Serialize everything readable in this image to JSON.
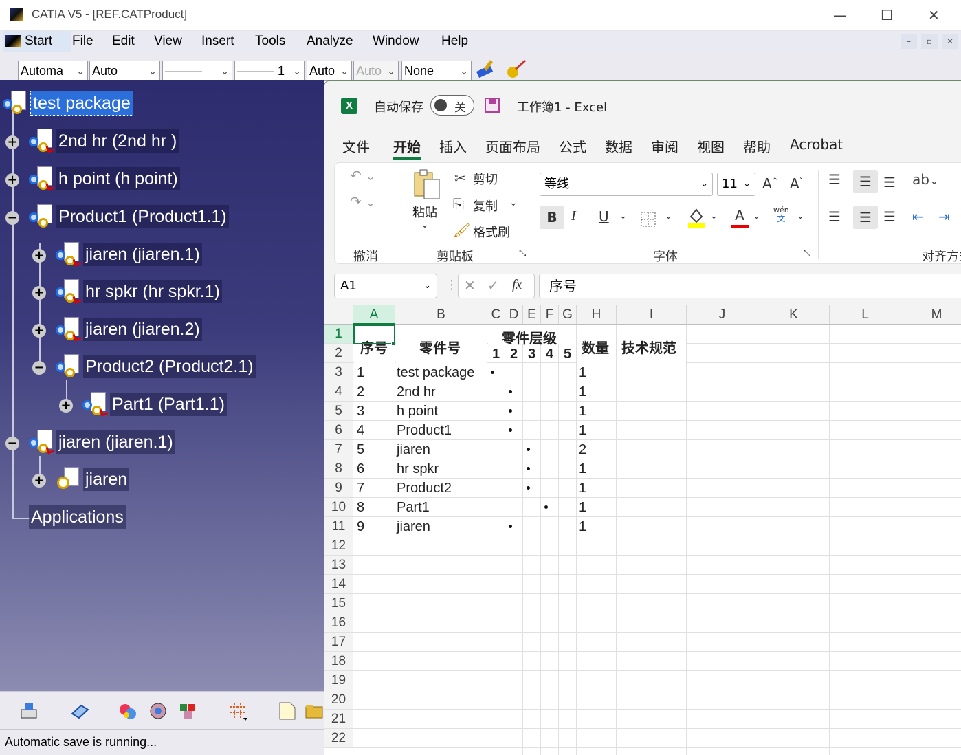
{
  "catia": {
    "title": "CATIA V5 - [REF.CATProduct]",
    "window_controls": {
      "minimize": "—",
      "maximize": "☐",
      "close": "✕"
    },
    "menu": [
      "Start",
      "File",
      "Edit",
      "View",
      "Insert",
      "Tools",
      "Analyze",
      "Window",
      "Help"
    ],
    "toolbar_selects": [
      "Automa",
      "Auto",
      "———",
      "——— 1",
      "Auto",
      "Auto",
      "None"
    ],
    "tree": [
      {
        "label": "test package",
        "level": 0,
        "expander": "",
        "selected": true
      },
      {
        "label": "2nd hr  (2nd hr )",
        "level": 0,
        "expander": "+"
      },
      {
        "label": "h point (h point)",
        "level": 0,
        "expander": "+"
      },
      {
        "label": "Product1 (Product1.1)",
        "level": 0,
        "expander": "−"
      },
      {
        "label": "jiaren (jiaren.1)",
        "level": 1,
        "expander": "+"
      },
      {
        "label": "hr spkr (hr spkr.1)",
        "level": 1,
        "expander": "+"
      },
      {
        "label": "jiaren (jiaren.2)",
        "level": 1,
        "expander": "+"
      },
      {
        "label": "Product2 (Product2.1)",
        "level": 1,
        "expander": "−"
      },
      {
        "label": "Part1 (Part1.1)",
        "level": 2,
        "expander": "+"
      },
      {
        "label": "jiaren (jiaren.1)",
        "level": 0,
        "expander": "−"
      },
      {
        "label": "jiaren",
        "level": 1,
        "expander": "+"
      },
      {
        "label": "Applications",
        "level": 0,
        "expander": ""
      }
    ],
    "status": "Automatic save is running..."
  },
  "excel": {
    "logo": "X",
    "autosave_label": "自动保存",
    "autosave_state": "关",
    "workbook_title": "工作簿1  -  Excel",
    "tabs": [
      "文件",
      "开始",
      "插入",
      "页面布局",
      "公式",
      "数据",
      "审阅",
      "视图",
      "帮助",
      "Acrobat"
    ],
    "active_tab": "开始",
    "ribbon": {
      "undo_group": "撤消",
      "paste": "粘贴",
      "cut": "剪切",
      "copy": "复制",
      "format_painter": "格式刷",
      "clipboard_group": "剪贴板",
      "font_name": "等线",
      "font_size": "11",
      "font_group": "字体",
      "align_group": "对齐方式",
      "bold": "B",
      "italic": "I",
      "underline": "U",
      "grow": "A^",
      "shrink": "Aˇ",
      "font_color": "A",
      "phonetic_top": "wén",
      "phonetic_bottom": "文"
    },
    "name_box": "A1",
    "formula": "序号",
    "fx": "fx",
    "columns": [
      "A",
      "B",
      "C",
      "D",
      "E",
      "F",
      "G",
      "H",
      "I",
      "J",
      "K",
      "L",
      "M"
    ],
    "rows": [
      "1",
      "2",
      "3",
      "4",
      "5",
      "6",
      "7",
      "8",
      "9",
      "10",
      "11",
      "12",
      "13",
      "14",
      "15",
      "16",
      "17",
      "18",
      "19",
      "20",
      "21",
      "22"
    ],
    "headers": {
      "seq": "序号",
      "part_no": "零件号",
      "level": "零件层级",
      "levels": [
        "1",
        "2",
        "3",
        "4",
        "5"
      ],
      "qty": "数量",
      "spec": "技术规范"
    },
    "table": [
      {
        "seq": "1",
        "part": "test package",
        "level": 1,
        "qty": "1"
      },
      {
        "seq": "2",
        "part": "2nd hr",
        "level": 2,
        "qty": "1"
      },
      {
        "seq": "3",
        "part": "h point",
        "level": 2,
        "qty": "1"
      },
      {
        "seq": "4",
        "part": "Product1",
        "level": 2,
        "qty": "1"
      },
      {
        "seq": "5",
        "part": "jiaren",
        "level": 3,
        "qty": "2"
      },
      {
        "seq": "6",
        "part": "hr spkr",
        "level": 3,
        "qty": "1"
      },
      {
        "seq": "7",
        "part": "Product2",
        "level": 3,
        "qty": "1"
      },
      {
        "seq": "8",
        "part": "Part1",
        "level": 4,
        "qty": "1"
      },
      {
        "seq": "9",
        "part": "jiaren",
        "level": 2,
        "qty": "1"
      }
    ],
    "accent": "#107c41"
  }
}
